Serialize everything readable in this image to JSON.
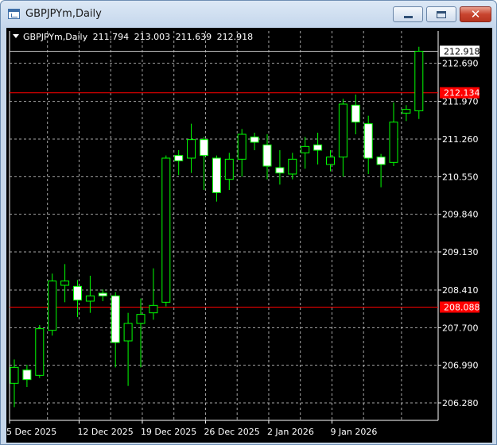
{
  "window": {
    "title": "GBPJPYm,Daily",
    "icon": "chart-window-icon",
    "controls": {
      "minimize_icon": "minimize-icon",
      "maximize_icon": "maximize-icon",
      "close_icon": "close-icon",
      "close_glyph": "✕"
    }
  },
  "chart_header": {
    "symbol": "GBPJPYm,Daily",
    "open": "211.794",
    "high": "213.003",
    "low": "211.639",
    "close": "212.918"
  },
  "colors": {
    "background": "#000000",
    "grid": "#d0d0d0",
    "axis_text": "#ffffff",
    "candle_bull_fill": "#000000",
    "candle_bear_fill": "#ffffff",
    "candle_outline": "#00ff00",
    "hline": "#ff0000",
    "bid_line": "#c0c0c0"
  },
  "chart_data": {
    "type": "candlestick",
    "symbol": "GBPJPYm",
    "timeframe": "Daily",
    "grid": true,
    "ylim": [
      205.95,
      213.3
    ],
    "y_ticks": [
      "212.690",
      "211.970",
      "211.260",
      "210.550",
      "209.840",
      "209.130",
      "208.410",
      "207.700",
      "206.990",
      "206.280"
    ],
    "x_ticks": [
      "5 Dec 2025",
      "12 Dec 2025",
      "19 Dec 2025",
      "26 Dec 2025",
      "2 Jan 2026",
      "9 Jan 2026"
    ],
    "price_labels": {
      "current": "212.918",
      "line_upper": "212.134",
      "line_lower": "208.088"
    },
    "horizontal_lines": [
      {
        "price": 212.134,
        "label": "212.134"
      },
      {
        "price": 208.088,
        "label": "208.088"
      }
    ],
    "current_price": 212.918,
    "candles": [
      {
        "x": 0.0,
        "o": 206.65,
        "h": 207.1,
        "l": 206.2,
        "c": 206.95
      },
      {
        "x": 1.0,
        "o": 206.9,
        "h": 207.0,
        "l": 206.58,
        "c": 206.72
      },
      {
        "x": 2.0,
        "o": 206.8,
        "h": 207.75,
        "l": 206.75,
        "c": 207.68
      },
      {
        "x": 3.0,
        "o": 207.65,
        "h": 208.72,
        "l": 207.55,
        "c": 208.58
      },
      {
        "x": 4.0,
        "o": 208.5,
        "h": 208.9,
        "l": 208.18,
        "c": 208.58
      },
      {
        "x": 5.0,
        "o": 208.48,
        "h": 208.6,
        "l": 207.9,
        "c": 208.22
      },
      {
        "x": 6.0,
        "o": 208.2,
        "h": 208.68,
        "l": 207.98,
        "c": 208.3
      },
      {
        "x": 7.0,
        "o": 208.35,
        "h": 208.42,
        "l": 208.2,
        "c": 208.3
      },
      {
        "x": 8.0,
        "o": 208.3,
        "h": 208.37,
        "l": 206.95,
        "c": 207.42
      },
      {
        "x": 9.0,
        "o": 207.45,
        "h": 207.98,
        "l": 206.6,
        "c": 207.78
      },
      {
        "x": 10.0,
        "o": 207.78,
        "h": 208.25,
        "l": 206.95,
        "c": 207.95
      },
      {
        "x": 11.0,
        "o": 207.98,
        "h": 208.82,
        "l": 207.85,
        "c": 208.12
      },
      {
        "x": 12.0,
        "o": 208.18,
        "h": 210.95,
        "l": 208.1,
        "c": 210.9
      },
      {
        "x": 13.0,
        "o": 210.95,
        "h": 211.05,
        "l": 210.58,
        "c": 210.85
      },
      {
        "x": 14.0,
        "o": 210.9,
        "h": 211.55,
        "l": 210.62,
        "c": 211.25
      },
      {
        "x": 15.0,
        "o": 211.25,
        "h": 211.3,
        "l": 210.3,
        "c": 210.95
      },
      {
        "x": 16.0,
        "o": 210.9,
        "h": 210.95,
        "l": 210.08,
        "c": 210.25
      },
      {
        "x": 17.0,
        "o": 210.5,
        "h": 211.0,
        "l": 210.3,
        "c": 210.88
      },
      {
        "x": 18.0,
        "o": 210.88,
        "h": 211.45,
        "l": 210.55,
        "c": 211.35
      },
      {
        "x": 19.0,
        "o": 211.3,
        "h": 211.38,
        "l": 211.05,
        "c": 211.2
      },
      {
        "x": 20.0,
        "o": 211.15,
        "h": 211.35,
        "l": 210.5,
        "c": 210.75
      },
      {
        "x": 21.0,
        "o": 210.72,
        "h": 211.05,
        "l": 210.4,
        "c": 210.62
      },
      {
        "x": 22.0,
        "o": 210.6,
        "h": 211.0,
        "l": 210.5,
        "c": 210.88
      },
      {
        "x": 23.0,
        "o": 211.0,
        "h": 211.3,
        "l": 210.7,
        "c": 211.12
      },
      {
        "x": 24.0,
        "o": 211.15,
        "h": 211.38,
        "l": 210.78,
        "c": 211.05
      },
      {
        "x": 25.0,
        "o": 210.78,
        "h": 211.05,
        "l": 210.65,
        "c": 210.92
      },
      {
        "x": 26.0,
        "o": 210.92,
        "h": 212.02,
        "l": 210.55,
        "c": 211.92
      },
      {
        "x": 27.0,
        "o": 211.9,
        "h": 212.1,
        "l": 211.35,
        "c": 211.58
      },
      {
        "x": 28.0,
        "o": 211.55,
        "h": 211.7,
        "l": 210.6,
        "c": 210.9
      },
      {
        "x": 29.0,
        "o": 210.92,
        "h": 210.98,
        "l": 210.35,
        "c": 210.78
      },
      {
        "x": 30.0,
        "o": 210.82,
        "h": 211.95,
        "l": 210.75,
        "c": 211.58
      },
      {
        "x": 31.0,
        "o": 211.75,
        "h": 211.9,
        "l": 211.6,
        "c": 211.82
      },
      {
        "x": 32.0,
        "o": 211.794,
        "h": 213.003,
        "l": 211.639,
        "c": 212.918
      }
    ],
    "x_tick_positions": [
      0,
      5,
      10,
      15,
      20,
      25
    ]
  }
}
